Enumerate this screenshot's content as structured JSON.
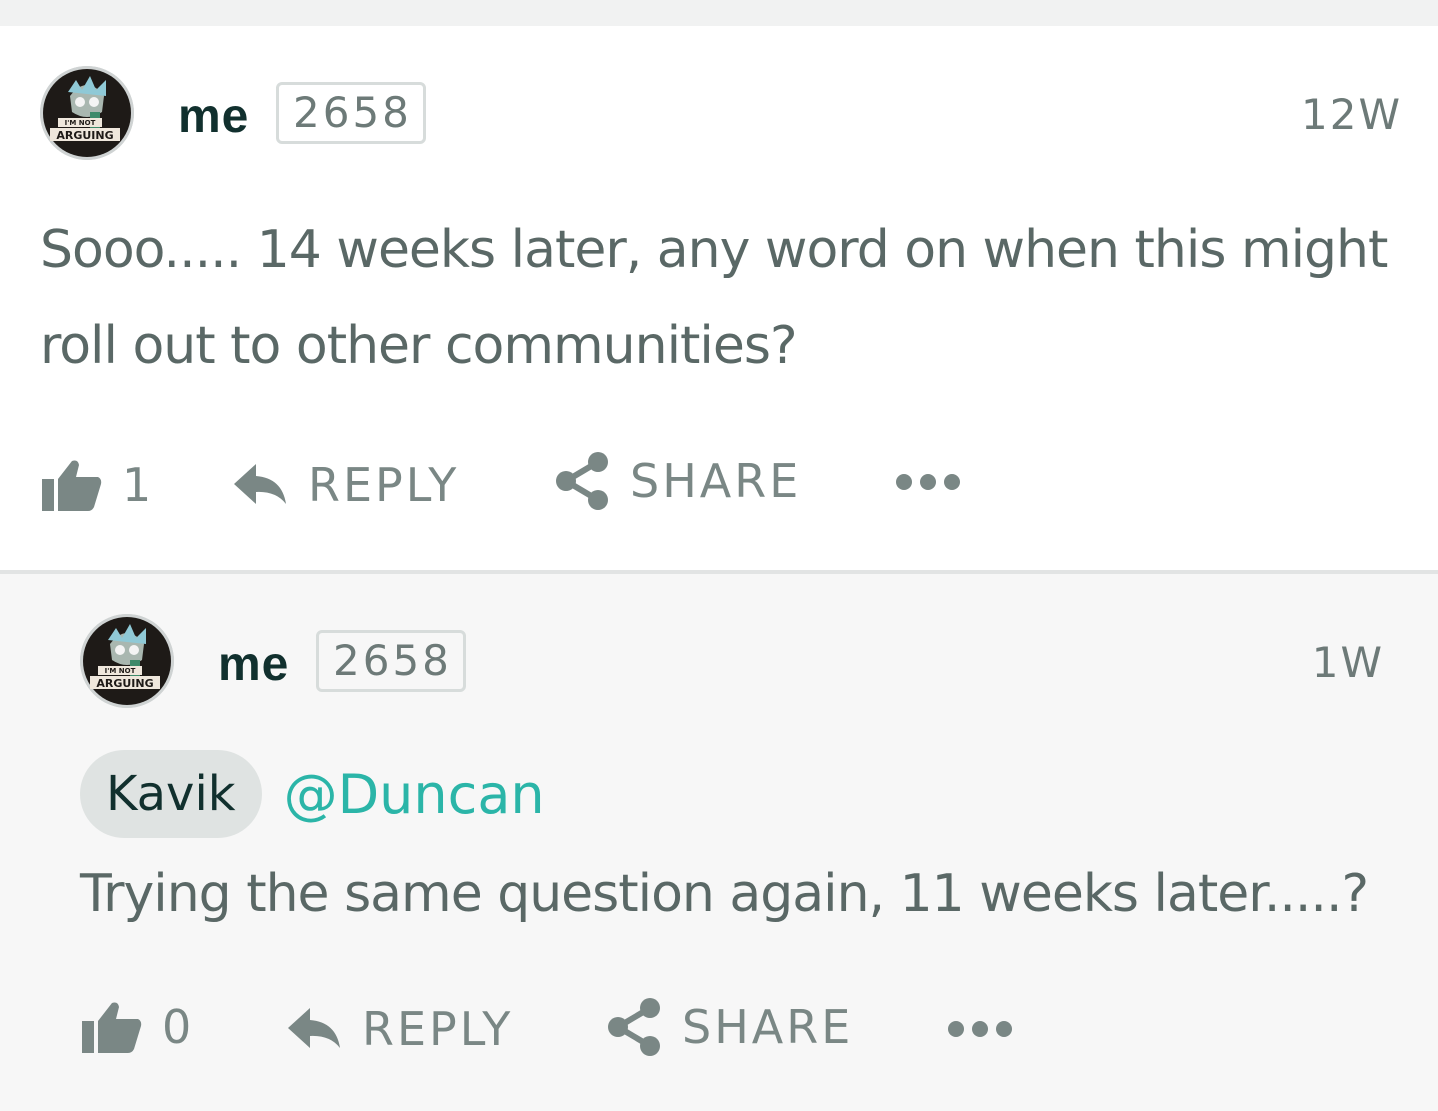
{
  "comments": [
    {
      "username": "me",
      "points": "2658",
      "time": "12W",
      "text_lines": [
        "Sooo..... 14 weeks later, any word on when this might",
        "roll out to other communities?"
      ],
      "likes": "1",
      "reply_label": "REPLY",
      "share_label": "SHARE",
      "avatar_text_1": "I'M NOT",
      "avatar_text_2": "ARGUING"
    },
    {
      "username": "me",
      "points": "2658",
      "time": "1W",
      "chip_label": "Kavik",
      "mention": "@Duncan",
      "text": "Trying the same question again, 11 weeks later.....?",
      "likes": "0",
      "reply_label": "REPLY",
      "share_label": "SHARE",
      "avatar_text_1": "I'M NOT",
      "avatar_text_2": "ARGUING"
    }
  ],
  "icons": {
    "like": "thumbs-up-icon",
    "reply": "reply-arrow-icon",
    "share": "share-icon",
    "more": "more-horizontal-icon"
  },
  "colors": {
    "username": "#11302e",
    "body_text": "#5a6866",
    "mention": "#2bb5a8",
    "action": "#7a8785",
    "chip_bg": "#dfe3e2"
  }
}
